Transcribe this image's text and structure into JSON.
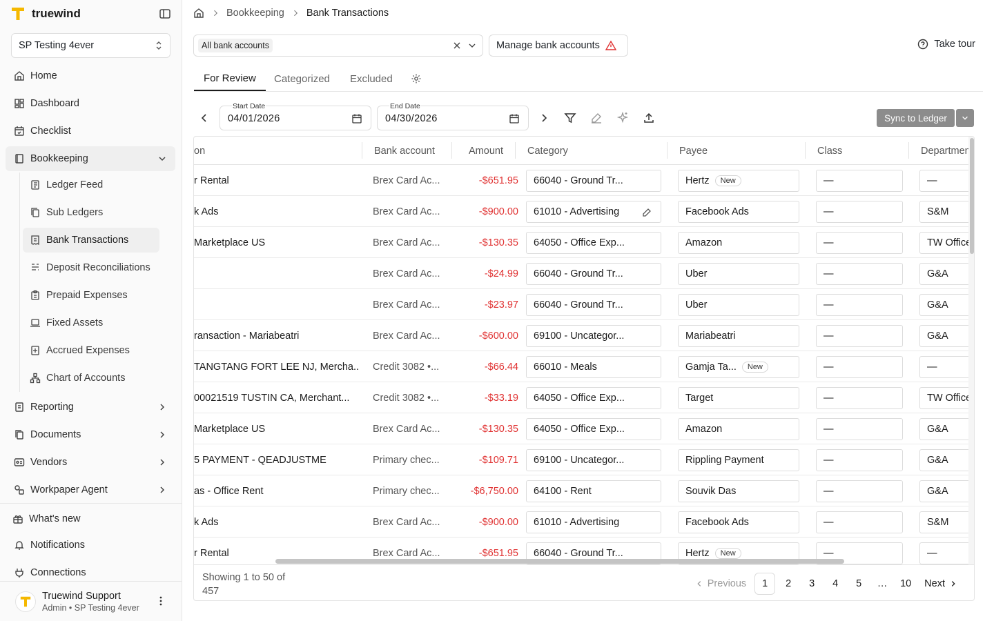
{
  "app": {
    "name": "truewind"
  },
  "workspace": {
    "name": "SP Testing 4ever"
  },
  "nav": {
    "home": "Home",
    "dashboard": "Dashboard",
    "checklist": "Checklist",
    "bookkeeping": "Bookkeeping",
    "sub": [
      "Ledger Feed",
      "Sub Ledgers",
      "Bank Transactions",
      "Deposit Reconciliations",
      "Prepaid Expenses",
      "Fixed Assets",
      "Accrued Expenses",
      "Chart of Accounts"
    ],
    "reporting": "Reporting",
    "documents": "Documents",
    "vendors": "Vendors",
    "workpaper": "Workpaper Agent",
    "whats_new": "What's new",
    "notifications": "Notifications",
    "connections": "Connections"
  },
  "user": {
    "name": "Truewind Support",
    "role": "Admin • SP Testing 4ever"
  },
  "breadcrumb": {
    "parent": "Bookkeeping",
    "current": "Bank Transactions"
  },
  "filters": {
    "accounts_chip": "All bank accounts",
    "manage_label": "Manage bank accounts",
    "tour_label": "Take tour"
  },
  "tabs": [
    "For Review",
    "Categorized",
    "Excluded"
  ],
  "dates": {
    "start_label": "Start Date",
    "start_value": "04/01/2026",
    "end_label": "End Date",
    "end_value": "04/30/2026"
  },
  "sync": {
    "label": "Sync to Ledger"
  },
  "colors": {
    "accent": "#f5b800",
    "negative": "#e03131"
  },
  "table": {
    "columns": [
      "on",
      "Bank account",
      "Amount",
      "Category",
      "Payee",
      "Class",
      "Department"
    ],
    "rows": [
      {
        "desc": "r Rental",
        "bank": "Brex Card Ac...",
        "amount": "-$651.95",
        "category": "66040 - Ground Tr...",
        "payee": "Hertz",
        "new": "New",
        "class": "—",
        "dept": "—"
      },
      {
        "desc": "k Ads",
        "bank": "Brex Card Ac...",
        "amount": "-$900.00",
        "category": "61010 - Advertising",
        "payee": "Facebook Ads",
        "new": "",
        "class": "—",
        "dept": "S&M"
      },
      {
        "desc": "Marketplace US",
        "bank": "Brex Card Ac...",
        "amount": "-$130.35",
        "category": "64050 - Office Exp...",
        "payee": "Amazon",
        "new": "",
        "class": "—",
        "dept": "TW Office"
      },
      {
        "desc": "",
        "bank": "Brex Card Ac...",
        "amount": "-$24.99",
        "category": "66040 - Ground Tr...",
        "payee": "Uber",
        "new": "",
        "class": "—",
        "dept": "G&A"
      },
      {
        "desc": "",
        "bank": "Brex Card Ac...",
        "amount": "-$23.97",
        "category": "66040 - Ground Tr...",
        "payee": "Uber",
        "new": "",
        "class": "—",
        "dept": "G&A"
      },
      {
        "desc": "ransaction - Mariabeatri",
        "bank": "Brex Card Ac...",
        "amount": "-$600.00",
        "category": "69100 - Uncategor...",
        "payee": "Mariabeatri",
        "new": "",
        "class": "—",
        "dept": "G&A"
      },
      {
        "desc": "TANGTANG FORT LEE NJ, Mercha...",
        "bank": "Credit 3082 •...",
        "amount": "-$66.44",
        "category": "66010 - Meals",
        "payee": "Gamja Ta...",
        "new": "New",
        "class": "—",
        "dept": "—"
      },
      {
        "desc": "00021519 TUSTIN CA, Merchant...",
        "bank": "Credit 3082 •...",
        "amount": "-$33.19",
        "category": "64050 - Office Exp...",
        "payee": "Target",
        "new": "",
        "class": "—",
        "dept": "TW Office"
      },
      {
        "desc": "Marketplace US",
        "bank": "Brex Card Ac...",
        "amount": "-$130.35",
        "category": "64050 - Office Exp...",
        "payee": "Amazon",
        "new": "",
        "class": "—",
        "dept": "G&A"
      },
      {
        "desc": "5 PAYMENT - QEADJUSTME",
        "bank": "Primary chec...",
        "amount": "-$109.71",
        "category": "69100 - Uncategor...",
        "payee": "Rippling Payment",
        "new": "",
        "class": "—",
        "dept": "G&A"
      },
      {
        "desc": "as - Office Rent",
        "bank": "Primary chec...",
        "amount": "-$6,750.00",
        "category": "64100 - Rent",
        "payee": "Souvik Das",
        "new": "",
        "class": "—",
        "dept": "G&A"
      },
      {
        "desc": "k Ads",
        "bank": "Brex Card Ac...",
        "amount": "-$900.00",
        "category": "61010 - Advertising",
        "payee": "Facebook Ads",
        "new": "",
        "class": "—",
        "dept": "S&M"
      },
      {
        "desc": "r Rental",
        "bank": "Brex Card Ac...",
        "amount": "-$651.95",
        "category": "66040 - Ground Tr...",
        "payee": "Hertz",
        "new": "New",
        "class": "—",
        "dept": "—"
      }
    ]
  },
  "pagination": {
    "showing": "Showing 1 to 50 of 457",
    "previous": "Previous",
    "next": "Next",
    "pages": [
      "1",
      "2",
      "3",
      "4",
      "5",
      "…",
      "10"
    ]
  }
}
